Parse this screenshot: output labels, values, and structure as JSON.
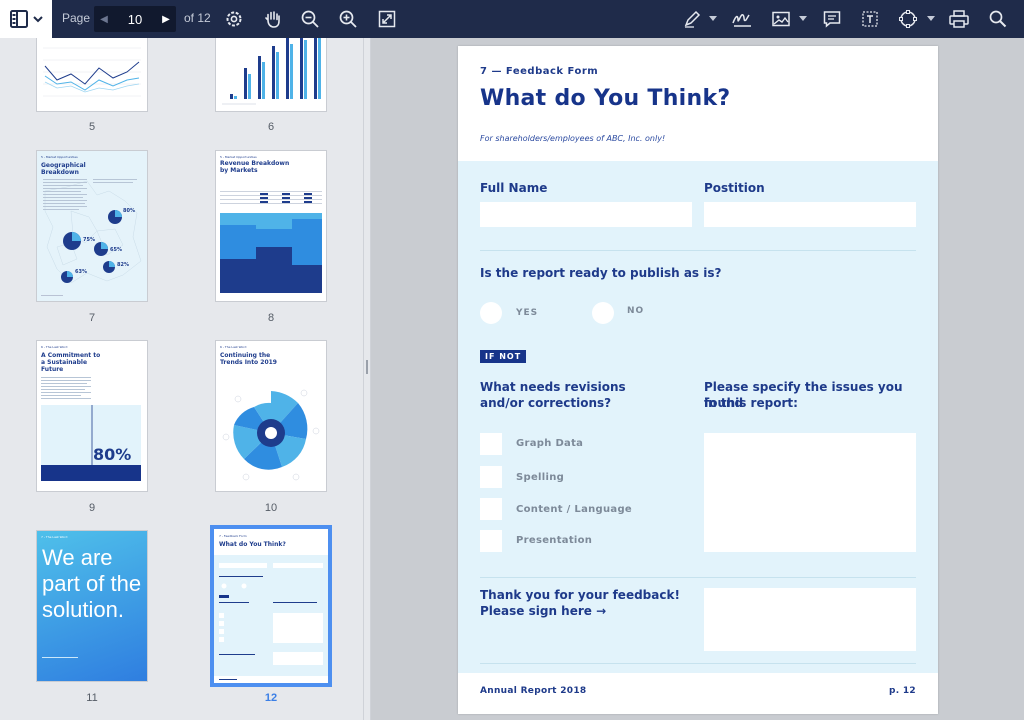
{
  "toolbar": {
    "page_label": "Page",
    "current_page": "10",
    "of_total": "of 12",
    "icons": [
      "sidebar-toggle-icon",
      "settings-icon",
      "pan-hand-icon",
      "zoom-out-icon",
      "zoom-in-icon",
      "fullscreen-icon",
      "pen-icon",
      "signature-icon",
      "image-icon",
      "comment-icon",
      "text-box-icon",
      "shape-icon",
      "print-icon",
      "search-icon"
    ]
  },
  "sidebar": {
    "thumbnails": [
      {
        "num": "5",
        "selected": false
      },
      {
        "num": "6",
        "selected": false
      },
      {
        "num": "7",
        "selected": false,
        "title": "Geographical Breakdown",
        "tag": "5 - Market Opportunities",
        "stats": [
          "80%",
          "75%",
          "65%",
          "82%",
          "63%"
        ]
      },
      {
        "num": "8",
        "selected": false,
        "title": "Revenue Breakdown by Markets",
        "tag": "5 - Market Opportunities"
      },
      {
        "num": "9",
        "selected": false,
        "title": "A Commitment to a Sustainable Future",
        "tag": "6 - The Last Word",
        "stat": "80%"
      },
      {
        "num": "10",
        "selected": false,
        "title": "Continuing the Trends Into 2019",
        "tag": "6 - The Last Word"
      },
      {
        "num": "11",
        "selected": false,
        "tag": "7 - The Last Word",
        "title": "We are part of the solution."
      },
      {
        "num": "12",
        "selected": true,
        "tag": "7 - Feedback Form",
        "title": "What do You Think?"
      }
    ]
  },
  "document": {
    "kicker": "7 — Feedback Form",
    "title": "What do You Think?",
    "subtitle": "For shareholders/employees of ABC, Inc. only!",
    "full_name_label": "Full Name",
    "position_label": "Postition",
    "question_ready": "Is the report ready to publish as is?",
    "yes_label": "YES",
    "no_label": "NO",
    "if_not_badge": "IF NOT",
    "revisions_question_1": "What needs revisions",
    "revisions_question_2": "and/or corrections?",
    "issues_question_1": "Please specify the issues you found",
    "issues_question_2": "in this report:",
    "checkboxes": [
      "Graph Data",
      "Spelling",
      "Content / Language",
      "Presentation"
    ],
    "thanks_1": "Thank you for your feedback!",
    "thanks_2": "Please sign here →",
    "footer_left": "Annual Report 2018",
    "footer_right": "p. 12"
  },
  "colors": {
    "toolbar_bg": "#1f2b4a",
    "accent_blue": "#17348a",
    "form_bg": "#e2f3fb",
    "selected_thumb": "#4d8ff0"
  }
}
